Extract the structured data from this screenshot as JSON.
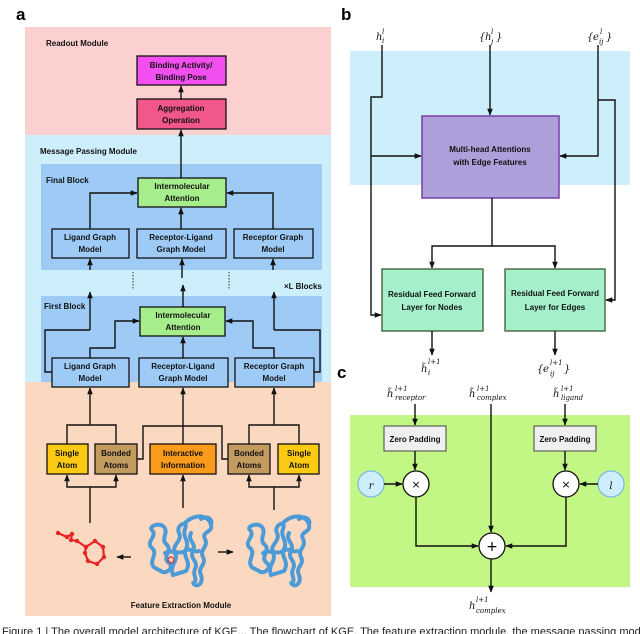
{
  "figure": {
    "panel_labels": {
      "a": "a",
      "b": "b",
      "c": "c"
    },
    "colors": {
      "readout_bg": "#fdd0d0",
      "message_bg": "#cdeefb",
      "block_bg": "#9dcbf6",
      "feature_bg": "#fbd9c1",
      "binding_box": "#f24ef0",
      "aggregation_box": "#f2578a",
      "attention_box": "#a6ee8c",
      "graph_box": "#9dcbf6",
      "single_atom": "#fdca13",
      "bonded_atoms": "#c39b5f",
      "interactive": "#fb9b1c",
      "ligand_red": "#e82424",
      "protein_blue": "#4c9ad6",
      "panel_b_bg": "#cdeefb",
      "mha_box": "#ad9fd9",
      "mha_border": "#7b3fa8",
      "residual_box": "#a5f0cb",
      "panel_c_bg": "#c2f685",
      "zero_pad_box": "#efefef",
      "scalar_circle": "#cdeefb"
    },
    "panel_a": {
      "readout": {
        "title": "Readout Module",
        "binding": [
          "Binding Activity/",
          "Binding Pose"
        ],
        "aggregation": [
          "Aggregation",
          "Operation"
        ]
      },
      "message_passing": {
        "title": "Message Passing Module",
        "repeat_label": "×L Blocks",
        "final_block": {
          "title": "Final Block",
          "attention": [
            "Intermolecular",
            "Attention"
          ],
          "ligand": [
            "Ligand Graph",
            "Model"
          ],
          "receptor_ligand": [
            "Receptor-Ligand",
            "Graph Model"
          ],
          "receptor": [
            "Receptor Graph",
            "Model"
          ]
        },
        "first_block": {
          "title": "First Block",
          "attention": [
            "Intermolecular",
            "Attention"
          ],
          "ligand": [
            "Ligand Graph",
            "Model"
          ],
          "receptor_ligand": [
            "Receptor-Ligand",
            "Graph Model"
          ],
          "receptor": [
            "Receptor Graph",
            "Model"
          ]
        }
      },
      "feature_extraction": {
        "title": "Feature Extraction Module",
        "single_atom_left": [
          "Single",
          "Atom"
        ],
        "bonded_left": [
          "Bonded",
          "Atoms"
        ],
        "interactive": [
          "Interactive",
          "Information"
        ],
        "bonded_right": [
          "Bonded",
          "Atoms"
        ],
        "single_atom_right": [
          "Single",
          "Atom"
        ],
        "images": [
          "ligand-molecule",
          "protein-ligand-complex",
          "receptor-protein"
        ]
      }
    },
    "panel_b": {
      "inputs": {
        "h_i": {
          "base": "h",
          "sup": "l",
          "sub": "i"
        },
        "h_j": {
          "open": "{",
          "base": "h",
          "sup": "l",
          "sub": "j",
          "close": "}"
        },
        "e_ij": {
          "open": "{",
          "base": "e",
          "sup": "l",
          "sub": "ij",
          "close": "}"
        }
      },
      "mha": [
        "Multi-head Attentions",
        "with Edge Features"
      ],
      "res_nodes": [
        "Residual Feed Forward",
        "Layer for Nodes"
      ],
      "res_edges": [
        "Residual Feed Forward",
        "Layer for Edges"
      ],
      "outputs": {
        "h_i": {
          "base": "h̃",
          "sup": "l+1",
          "sub": "i"
        },
        "e_ij": {
          "open": "{",
          "base": "e",
          "sup": "l+1",
          "sub": "ij",
          "close": "}"
        }
      }
    },
    "panel_c": {
      "inputs": {
        "receptor": {
          "base": "h̃",
          "sup": "l+1",
          "sub": "receptor"
        },
        "complex": {
          "base": "h̃",
          "sup": "l+1",
          "sub": "complex"
        },
        "ligand": {
          "base": "h̃",
          "sup": "l+1",
          "sub": "ligand"
        }
      },
      "zero_padding": "Zero Padding",
      "r_label": "r",
      "l_label": "l",
      "multiply": "×",
      "plus": "+",
      "output": {
        "base": "h",
        "sup": "l+1",
        "sub": "complex"
      }
    },
    "caption": "Figure 1 | The overall model architecture of KGE... The flowchart of KGE. The feature extraction module, the message passing module and the readout module"
  }
}
